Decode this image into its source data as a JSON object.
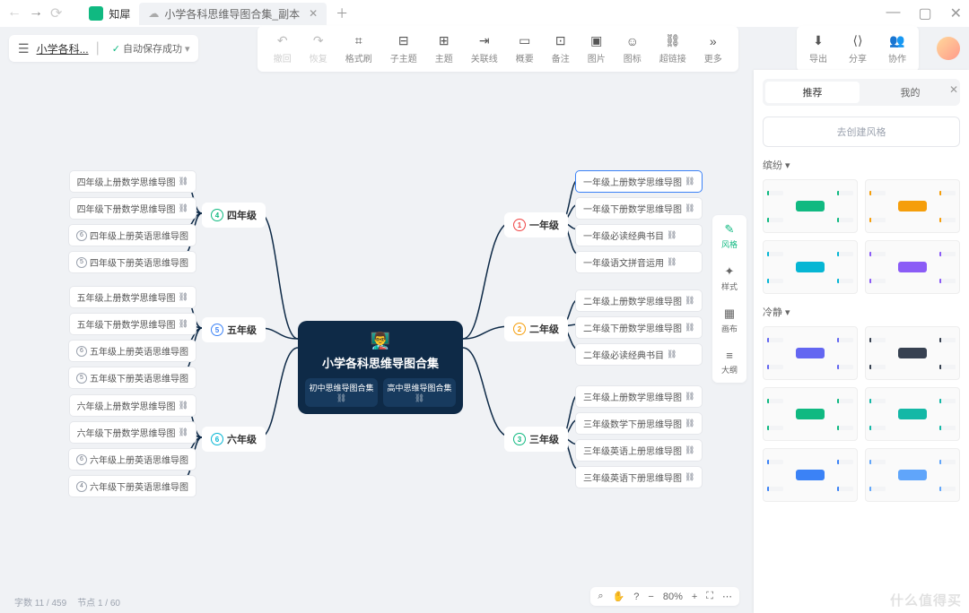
{
  "tabs": {
    "home": "知犀",
    "doc": "小学各科思维导图合集_副本"
  },
  "header": {
    "docname": "小学各科...",
    "autosave": "自动保存成功"
  },
  "toolbar": [
    {
      "icon": "↶",
      "label": "撤回"
    },
    {
      "icon": "↷",
      "label": "恢复"
    },
    {
      "icon": "⌗",
      "label": "格式刷"
    },
    {
      "icon": "⊟",
      "label": "子主题"
    },
    {
      "icon": "⊞",
      "label": "主题"
    },
    {
      "icon": "⇥",
      "label": "关联线"
    },
    {
      "icon": "▭",
      "label": "概要"
    },
    {
      "icon": "⊡",
      "label": "备注"
    },
    {
      "icon": "▣",
      "label": "图片"
    },
    {
      "icon": "☺",
      "label": "图标"
    },
    {
      "icon": "⛓",
      "label": "超链接"
    },
    {
      "icon": "»",
      "label": "更多"
    }
  ],
  "rightActions": [
    {
      "icon": "⬇",
      "label": "导出"
    },
    {
      "icon": "⟨⟩",
      "label": "分享"
    },
    {
      "icon": "👥",
      "label": "协作"
    }
  ],
  "center": {
    "title": "小学各科思维导图合集",
    "sub1": "初中思维导图合集",
    "sub2": "高中思维导图合集"
  },
  "grades": {
    "g1": "一年级",
    "g2": "二年级",
    "g3": "三年级",
    "g4": "四年级",
    "g5": "五年级",
    "g6": "六年级"
  },
  "leaves": {
    "g1": [
      "一年级上册数学思维导图",
      "一年级下册数学思维导图",
      "一年级必读经典书目",
      "一年级语文拼音运用"
    ],
    "g2": [
      "二年级上册数学思维导图",
      "二年级下册数学思维导图",
      "二年级必读经典书目"
    ],
    "g3": [
      "三年级上册数学思维导图",
      "三年级数学下册思维导图",
      "三年级英语上册思维导图",
      "三年级英语下册思维导图"
    ],
    "g4": [
      "四年级上册数学思维导图",
      "四年级下册数学思维导图",
      "四年级上册英语思维导图",
      "四年级下册英语思维导图"
    ],
    "g5": [
      "五年级上册数学思维导图",
      "五年级下册数学思维导图",
      "五年级上册英语思维导图",
      "五年级下册英语思维导图"
    ],
    "g6": [
      "六年级上册数学思维导图",
      "六年级下册数学思维导图",
      "六年级上册英语思维导图",
      "六年级下册英语思维导图"
    ]
  },
  "rail": [
    {
      "icon": "✎",
      "label": "风格"
    },
    {
      "icon": "✦",
      "label": "样式"
    },
    {
      "icon": "▦",
      "label": "画布"
    },
    {
      "icon": "≡",
      "label": "大纲"
    }
  ],
  "panel": {
    "tabs": [
      "推荐",
      "我的"
    ],
    "create": "去创建风格",
    "sec1": "缤纷",
    "sec2": "冷静"
  },
  "zoom": {
    "value": "80%"
  },
  "status": {
    "words": "字数 11 / 459",
    "nodes": "节点 1 / 60"
  },
  "watermark": "什么值得买"
}
